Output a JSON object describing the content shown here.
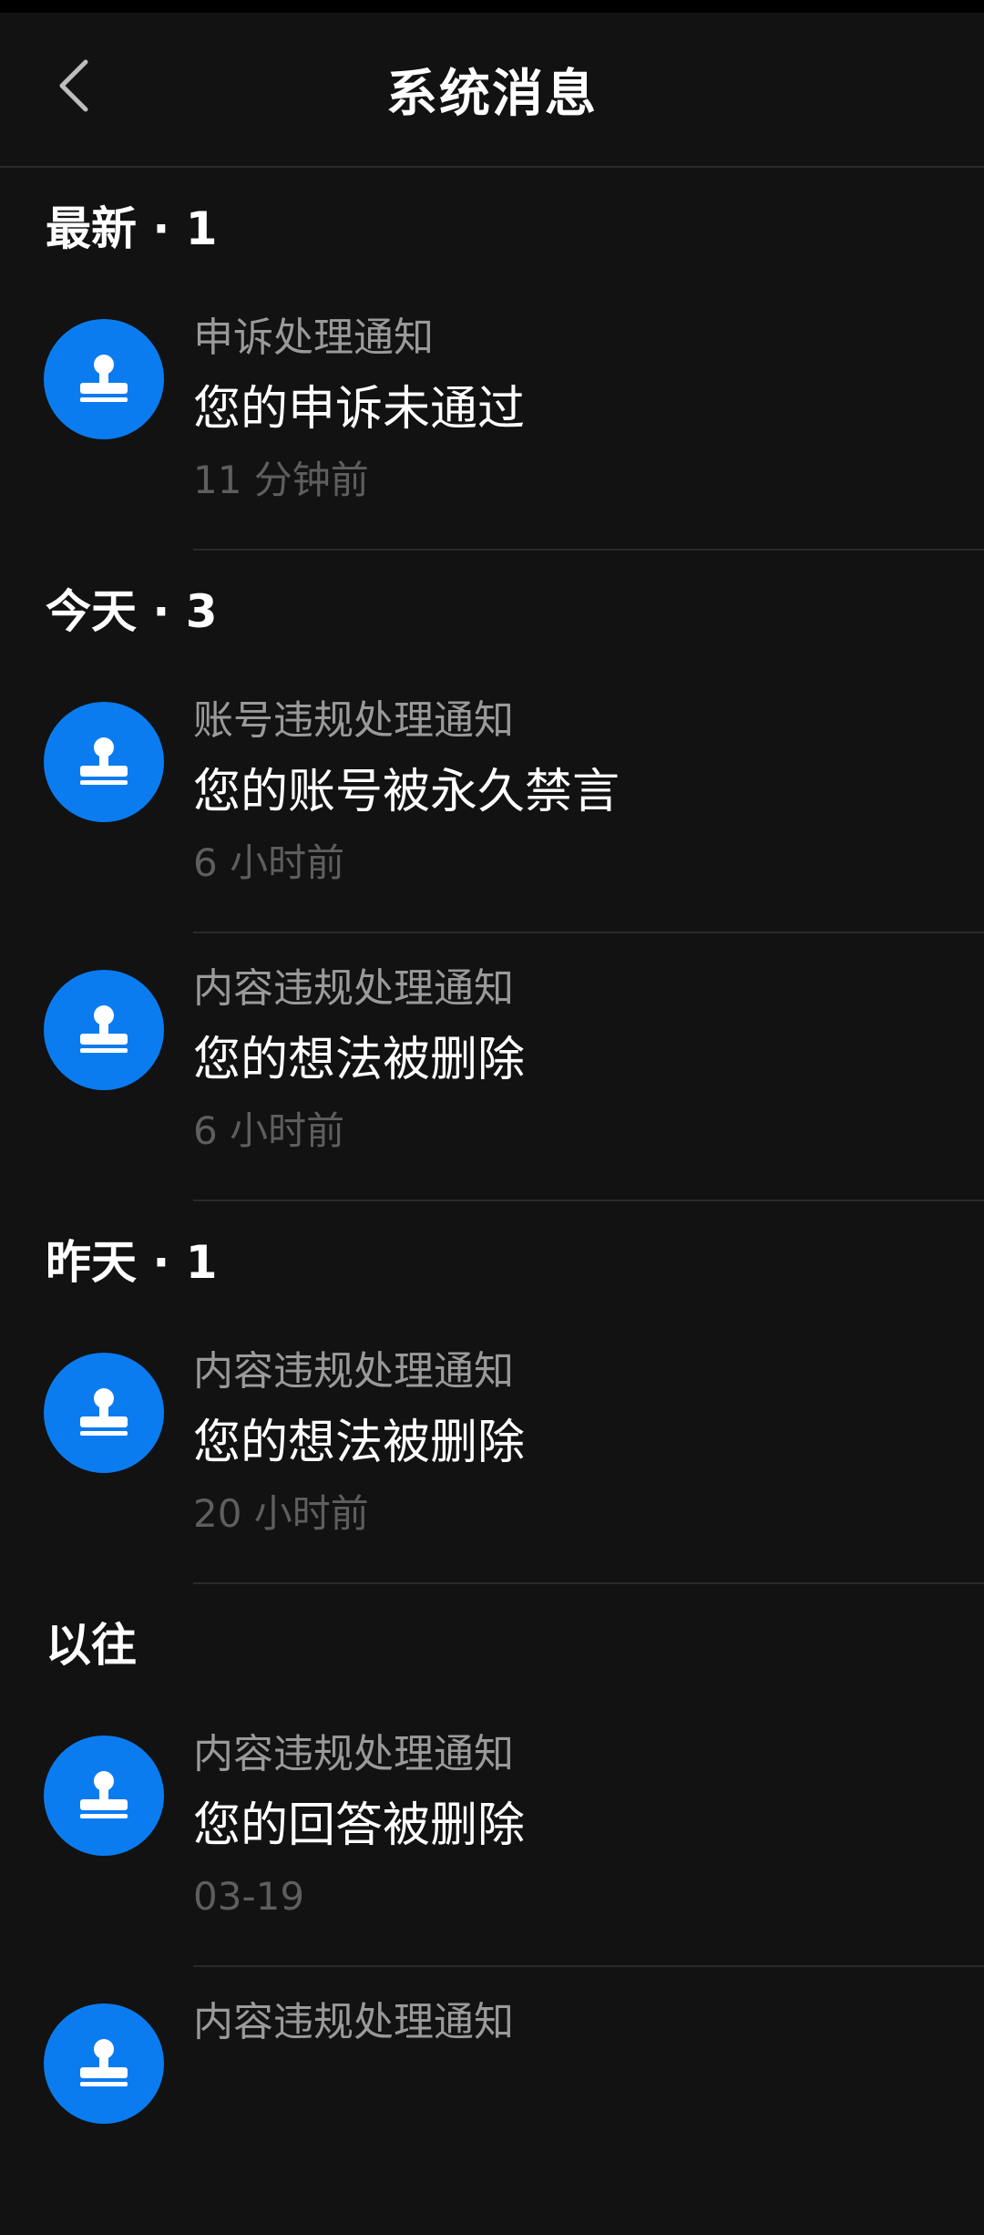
{
  "header": {
    "title": "系统消息",
    "back_icon": "chevron-left-icon"
  },
  "colors": {
    "background": "#121212",
    "avatar": "#0a7cf0",
    "category_text": "#9a9a9a",
    "time_text": "#5e5e5e"
  },
  "sections": [
    {
      "label": "最新 · 1",
      "items": [
        {
          "category": "申诉处理通知",
          "title": "您的申诉未通过",
          "time": "11 分钟前",
          "icon": "stamp-icon"
        }
      ]
    },
    {
      "label": "今天 · 3",
      "items": [
        {
          "category": "账号违规处理通知",
          "title": "您的账号被永久禁言",
          "time": "6 小时前",
          "icon": "stamp-icon"
        },
        {
          "category": "内容违规处理通知",
          "title": "您的想法被删除",
          "time": "6 小时前",
          "icon": "stamp-icon"
        }
      ]
    },
    {
      "label": "昨天 · 1",
      "items": [
        {
          "category": "内容违规处理通知",
          "title": "您的想法被删除",
          "time": "20 小时前",
          "icon": "stamp-icon"
        }
      ]
    },
    {
      "label": "以往",
      "items": [
        {
          "category": "内容违规处理通知",
          "title": "您的回答被删除",
          "time": "03-19",
          "icon": "stamp-icon"
        },
        {
          "category": "内容违规处理通知",
          "title": "",
          "time": "",
          "icon": "stamp-icon"
        }
      ]
    }
  ]
}
